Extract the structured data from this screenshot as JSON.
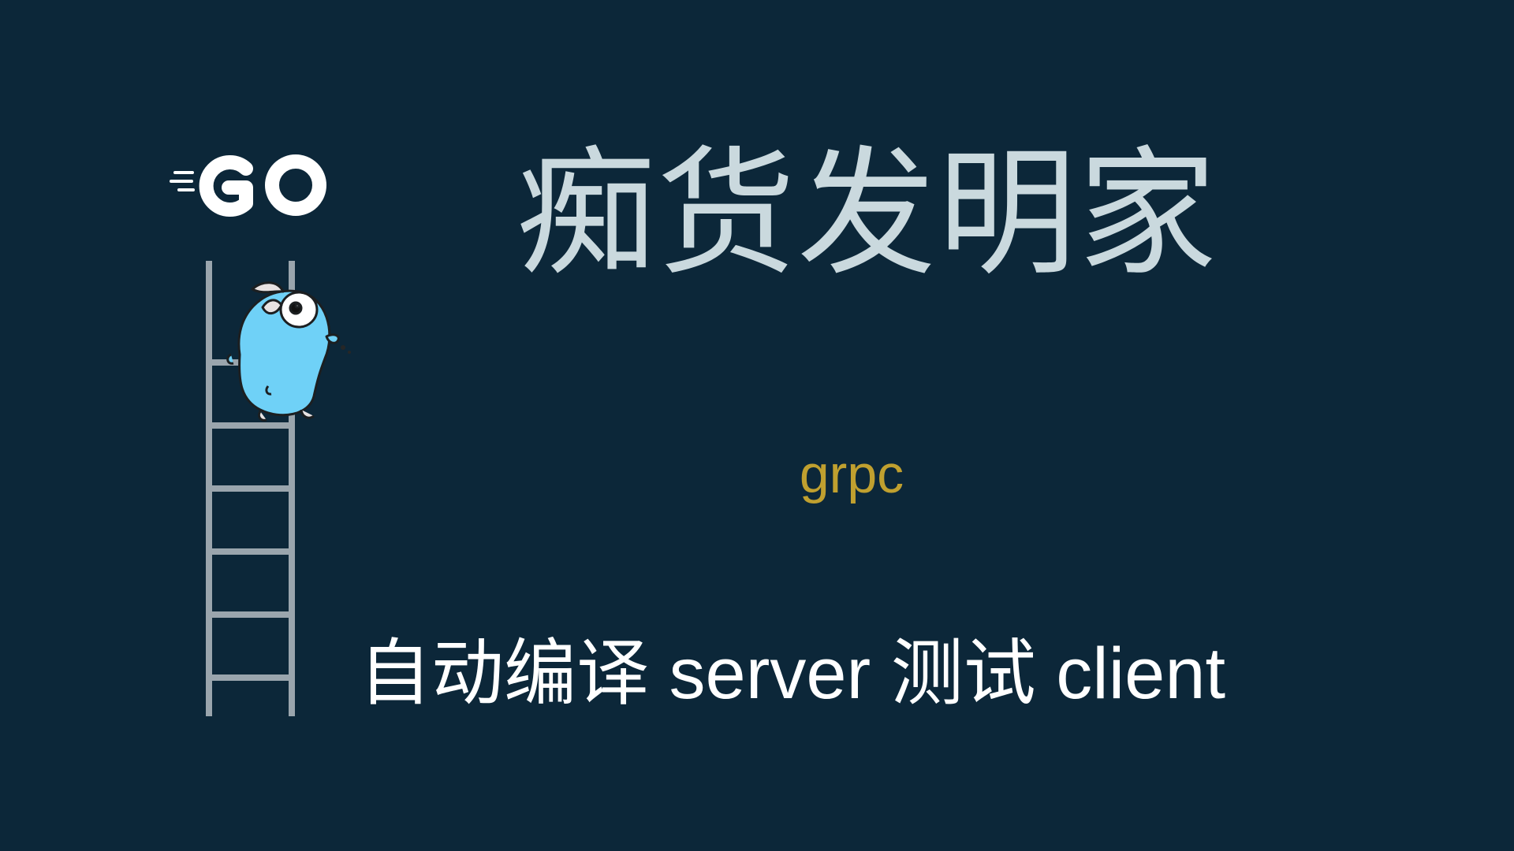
{
  "slide": {
    "title": "痴货发明家",
    "subtitle": "grpc",
    "caption": "自动编译 server 测试 client",
    "logo_text": "GO"
  },
  "colors": {
    "background": "#0c2739",
    "title": "#cad9de",
    "subtitle": "#c0a02f",
    "caption": "#ffffff",
    "gopher": "#6fd1f7",
    "ladder": "#9aa5ad"
  },
  "icons": {
    "logo": "go-logo-icon",
    "ladder": "ladder-icon",
    "gopher": "gopher-icon"
  }
}
